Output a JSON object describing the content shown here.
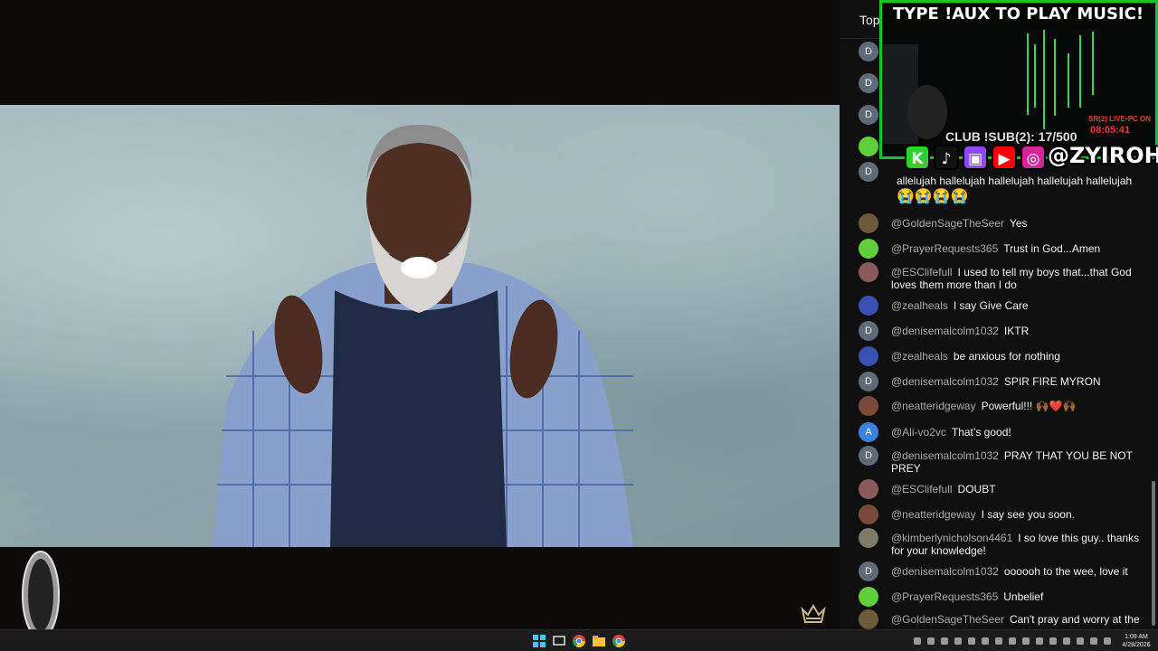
{
  "chat": {
    "header_label": "Top",
    "messages": [
      {
        "author": "@GoldenSageTheSeer",
        "text": "Yes",
        "avatar_color": "#6d5a3a",
        "avatar_letter": ""
      },
      {
        "author": "@PrayerRequests365",
        "text": "Trust in God...Amen",
        "avatar_color": "#5fcf3a",
        "avatar_letter": ""
      },
      {
        "author": "@ESClifefull",
        "text": "I used to tell my boys that...that God loves them more than I do",
        "avatar_color": "#8a5a5a",
        "avatar_letter": ""
      },
      {
        "author": "@zealheals",
        "text": "I say Give Care",
        "avatar_color": "#3a4fb0",
        "avatar_letter": ""
      },
      {
        "author": "@denisemalcolm1032",
        "text": "IKTR",
        "avatar_color": "#5f6b78",
        "avatar_letter": "D"
      },
      {
        "author": "@zealheals",
        "text": "be anxious for nothing",
        "avatar_color": "#3a4fb0",
        "avatar_letter": ""
      },
      {
        "author": "@denisemalcolm1032",
        "text": "SPIR FIRE MYRON",
        "avatar_color": "#5f6b78",
        "avatar_letter": "D"
      },
      {
        "author": "@neatteridgeway",
        "text": "Powerful!!! 🙌🏾❤️🙌🏾",
        "avatar_color": "#7a4a3a",
        "avatar_letter": ""
      },
      {
        "author": "@Ali-vo2vc",
        "text": "That’s good!",
        "avatar_color": "#3b82e0",
        "avatar_letter": "A"
      },
      {
        "author": "@denisemalcolm1032",
        "text": "PRAY THAT YOU BE NOT PREY",
        "avatar_color": "#5f6b78",
        "avatar_letter": "D"
      },
      {
        "author": "@ESClifefull",
        "text": "DOUBT",
        "avatar_color": "#8a5a5a",
        "avatar_letter": ""
      },
      {
        "author": "@neatteridgeway",
        "text": "I say see you soon.",
        "avatar_color": "#7a4a3a",
        "avatar_letter": ""
      },
      {
        "author": "@kimberlynicholson4461",
        "text": "I so love this guy.. thanks for your knowledge!",
        "avatar_color": "#7d7a68",
        "avatar_letter": ""
      },
      {
        "author": "@denisemalcolm1032",
        "text": "oooooh to the wee, love it",
        "avatar_color": "#5f6b78",
        "avatar_letter": "D"
      },
      {
        "author": "@PrayerRequests365",
        "text": "Unbelief",
        "avatar_color": "#5fcf3a",
        "avatar_letter": ""
      },
      {
        "author": "@GoldenSageTheSeer",
        "text": "Can't pray and worry at the",
        "avatar_color": "#6d5a3a",
        "avatar_letter": ""
      }
    ],
    "partial_top": {
      "avatars": [
        "D",
        "D",
        "D",
        "",
        "D"
      ],
      "partial_text": "allelujah hallelujah hallelujah hallelujah hallelujah",
      "partial_emoji": "😭😭😭😭"
    }
  },
  "overlay": {
    "title": "TYPE !AUX TO PLAY MUSIC!",
    "club_text": "CLUB !SUB(2): 17/500",
    "stat_text": "SR(2) LIVE•PC ON",
    "timer_text": "08:05:41",
    "handle": "@ZYIROH",
    "socials": [
      {
        "name": "kick-icon",
        "glyph": "K",
        "color": "#2fd12f"
      },
      {
        "name": "tiktok-icon",
        "glyph": "♪",
        "color": "#111111"
      },
      {
        "name": "twitch-icon",
        "glyph": "▣",
        "color": "#9146ff"
      },
      {
        "name": "youtube-icon",
        "glyph": "▶",
        "color": "#ff0000"
      },
      {
        "name": "instagram-icon",
        "glyph": "◎",
        "color": "#d6249f"
      }
    ]
  },
  "taskbar": {
    "time": "1:09 AM",
    "date": "4/28/2026"
  },
  "colors": {
    "overlay_border": "#19c32d",
    "chat_bg": "#0f0f0f",
    "author_text": "#aaaaaa"
  }
}
